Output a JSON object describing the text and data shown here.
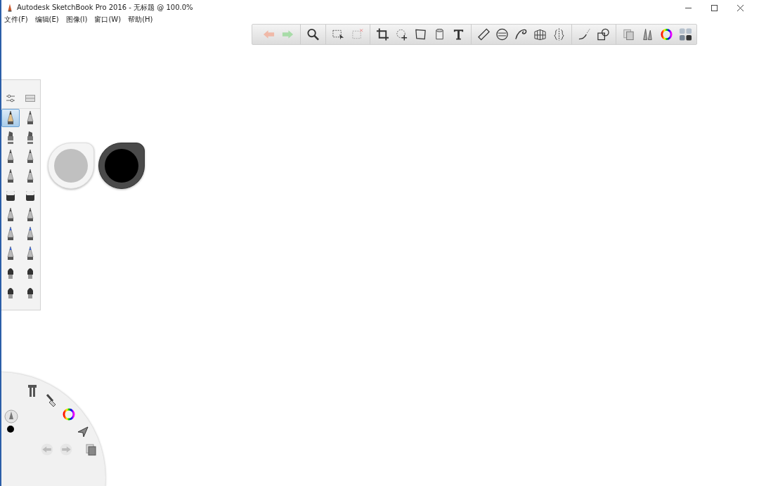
{
  "window": {
    "title": "Autodesk SketchBook Pro 2016 - 无标题 @ 100.0%"
  },
  "menu": [
    "文件(F)",
    "编辑(E)",
    "图像(I)",
    "窗口(W)",
    "帮助(H)"
  ],
  "brushes": [
    {
      "kind": "pencil",
      "selected": true
    },
    {
      "kind": "tech",
      "selected": false
    },
    {
      "kind": "marker",
      "selected": false
    },
    {
      "kind": "chisel",
      "selected": false
    },
    {
      "kind": "pen",
      "selected": false
    },
    {
      "kind": "nib",
      "selected": false
    },
    {
      "kind": "pen",
      "selected": false
    },
    {
      "kind": "nib",
      "selected": false
    },
    {
      "kind": "eraser",
      "selected": false
    },
    {
      "kind": "eraser",
      "selected": false
    },
    {
      "kind": "pen",
      "selected": false
    },
    {
      "kind": "nib",
      "selected": false
    },
    {
      "kind": "bluepen",
      "selected": false
    },
    {
      "kind": "bluepen",
      "selected": false
    },
    {
      "kind": "bluepen",
      "selected": false
    },
    {
      "kind": "bluepen",
      "selected": false
    },
    {
      "kind": "brush",
      "selected": false
    },
    {
      "kind": "brush",
      "selected": false
    },
    {
      "kind": "brush",
      "selected": false
    },
    {
      "kind": "brush",
      "selected": false
    }
  ],
  "pucks": [
    {
      "color": "#c0c0c0"
    },
    {
      "color": "#000000"
    }
  ]
}
